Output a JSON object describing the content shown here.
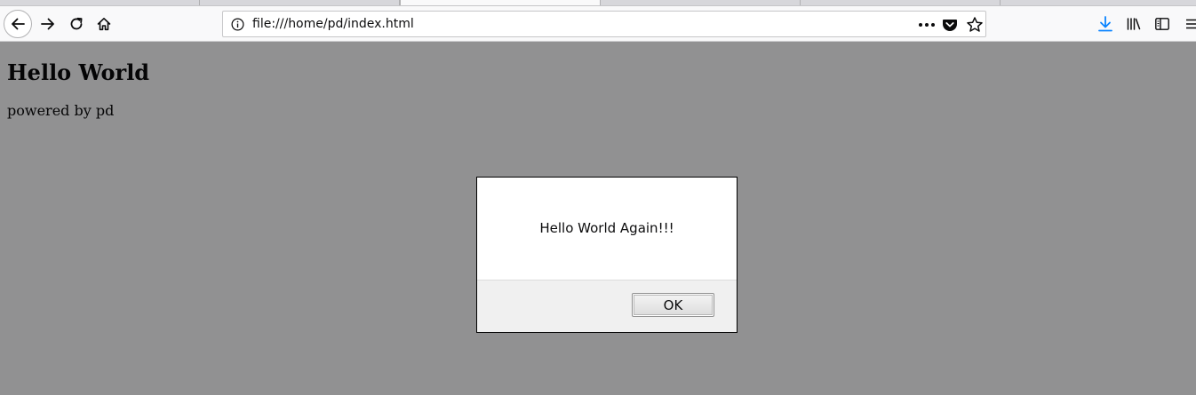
{
  "browser": {
    "url": "file:///home/pd/index.html",
    "colors": {
      "accent": "#0a84ff",
      "icon": "#0c0c0d"
    }
  },
  "page": {
    "heading": "Hello World",
    "paragraph": "powered by pd"
  },
  "dialog": {
    "message": "Hello World Again!!!",
    "ok_label": "OK"
  }
}
